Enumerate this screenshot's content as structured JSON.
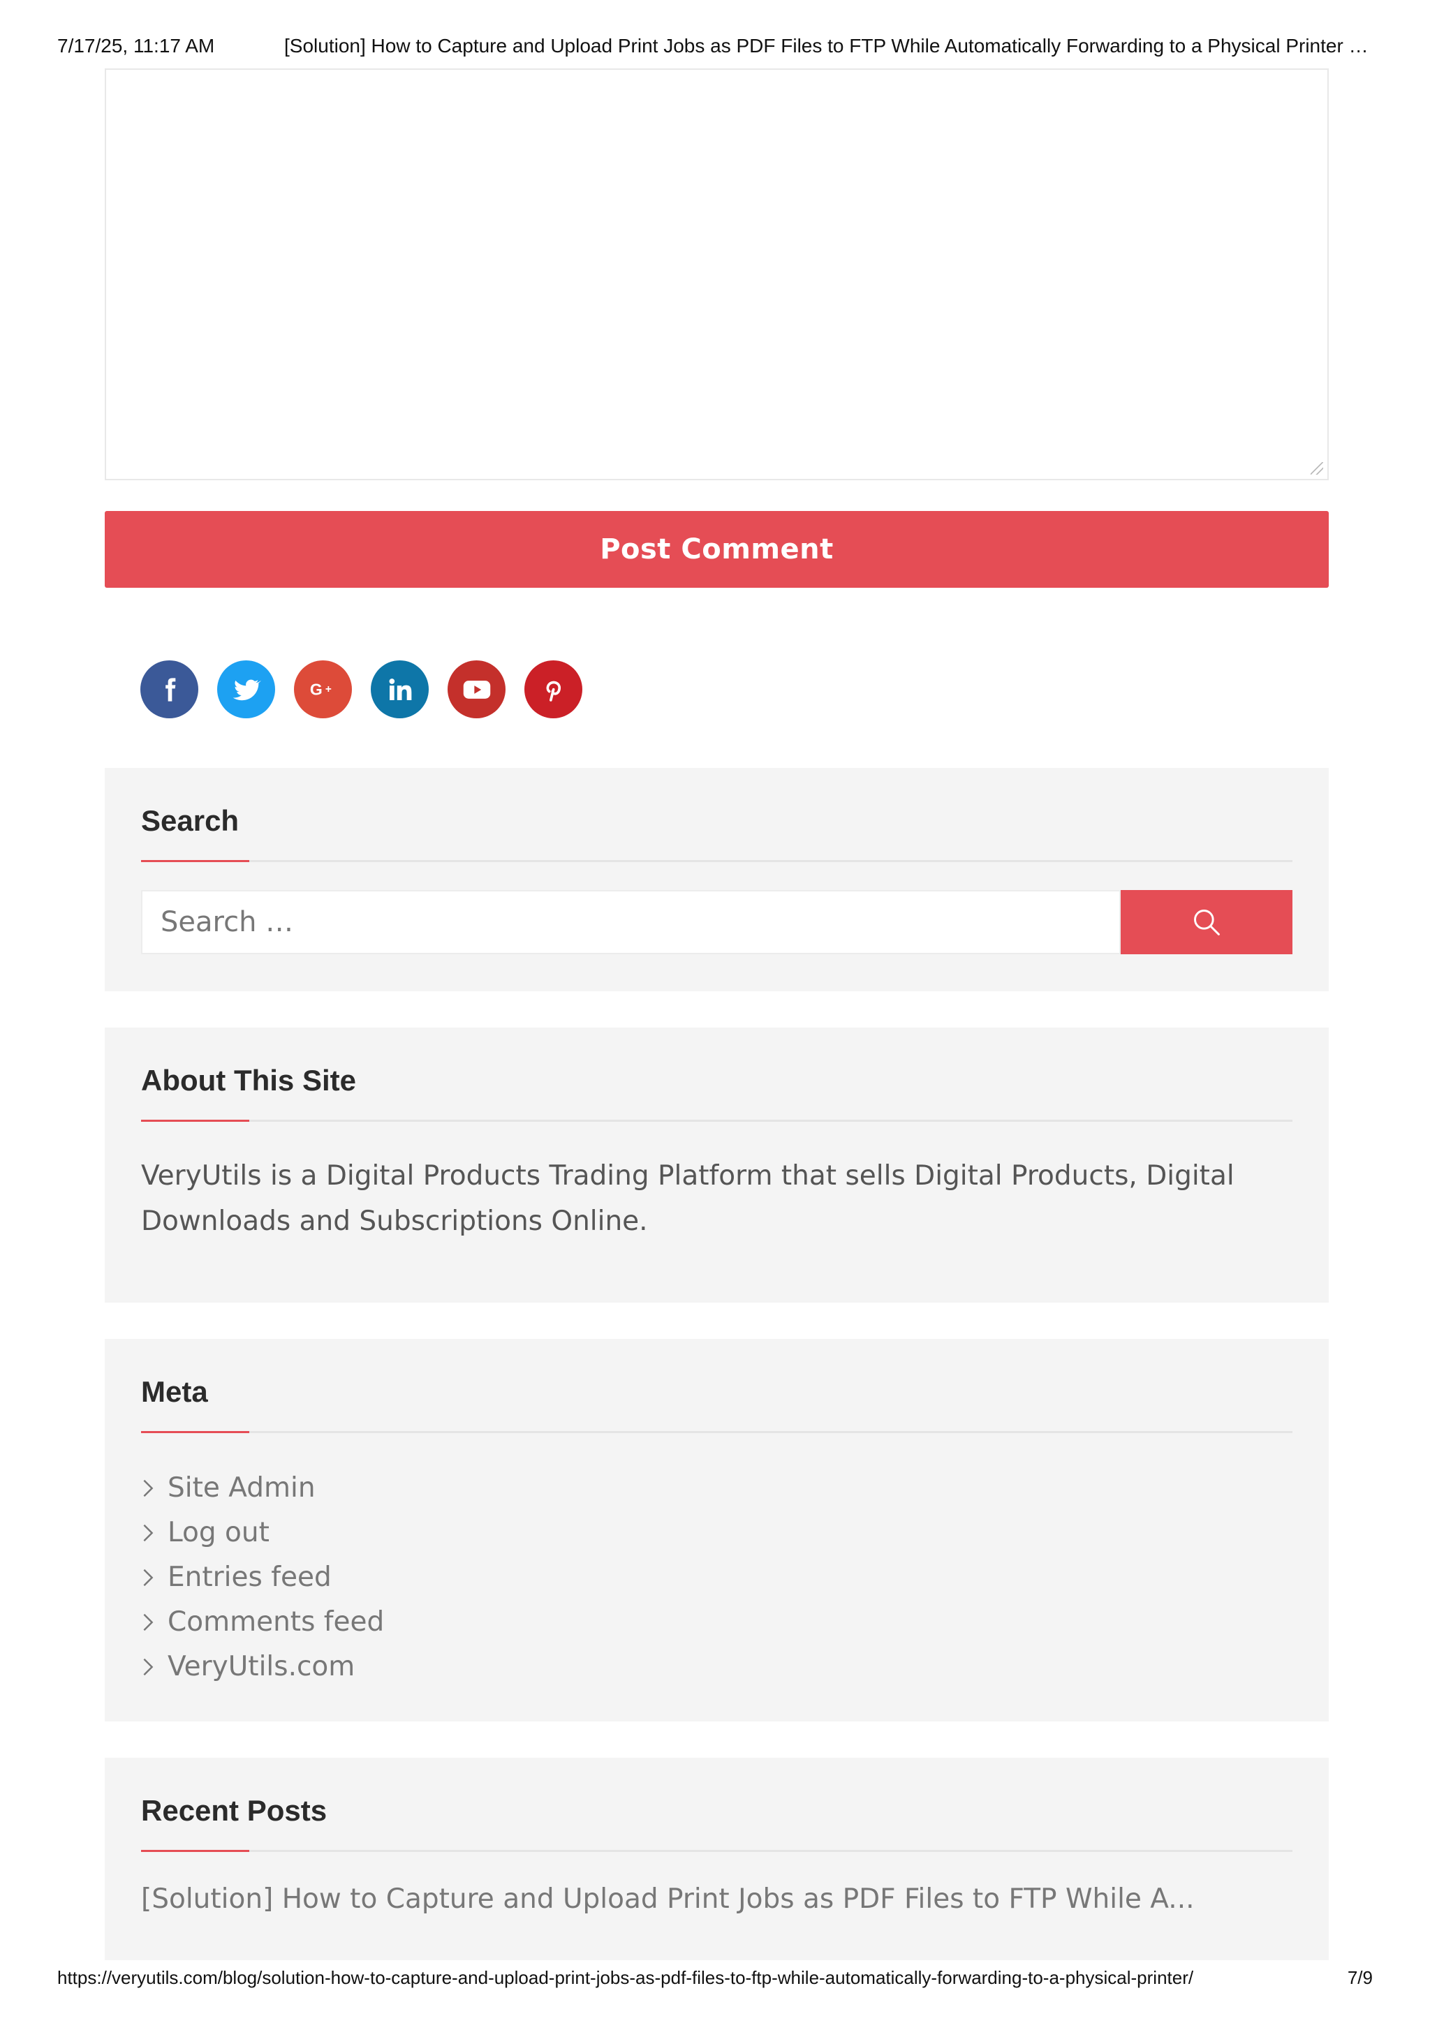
{
  "print_header": {
    "date": "7/17/25, 11:17 AM",
    "title": "[Solution] How to Capture and Upload Print Jobs as PDF Files to FTP While Automatically Forwarding to a Physical Printer | | …"
  },
  "comment_form": {
    "comment_value": "",
    "submit_label": "Post Comment"
  },
  "social": [
    {
      "name": "facebook",
      "icon": "facebook-icon",
      "color": "#3b5998"
    },
    {
      "name": "twitter",
      "icon": "twitter-icon",
      "color": "#1da1f2"
    },
    {
      "name": "google-plus",
      "icon": "google-plus-icon",
      "color": "#dd4b39"
    },
    {
      "name": "linkedin",
      "icon": "linkedin-icon",
      "color": "#0e76a8"
    },
    {
      "name": "youtube",
      "icon": "youtube-icon",
      "color": "#c4302b"
    },
    {
      "name": "pinterest",
      "icon": "pinterest-icon",
      "color": "#cb2027"
    }
  ],
  "search_widget": {
    "title": "Search",
    "placeholder": "Search …",
    "button_icon": "search-icon"
  },
  "about_widget": {
    "title": "About This Site",
    "text": "VeryUtils is a Digital Products Trading Platform that sells Digital Products, Digital Downloads and Subscriptions Online."
  },
  "meta_widget": {
    "title": "Meta",
    "links": [
      "Site Admin",
      "Log out",
      "Entries feed",
      "Comments feed",
      "VeryUtils.com"
    ]
  },
  "recent_posts_widget": {
    "title": "Recent Posts",
    "posts": [
      "[Solution] How to Capture and Upload Print Jobs as PDF Files to FTP While A..."
    ]
  },
  "print_footer": {
    "url": "https://veryutils.com/blog/solution-how-to-capture-and-upload-print-jobs-as-pdf-files-to-ftp-while-automatically-forwarding-to-a-physical-printer/",
    "page": "7/9"
  },
  "colors": {
    "accent": "#e54d55",
    "widget_bg": "#f4f4f4"
  }
}
